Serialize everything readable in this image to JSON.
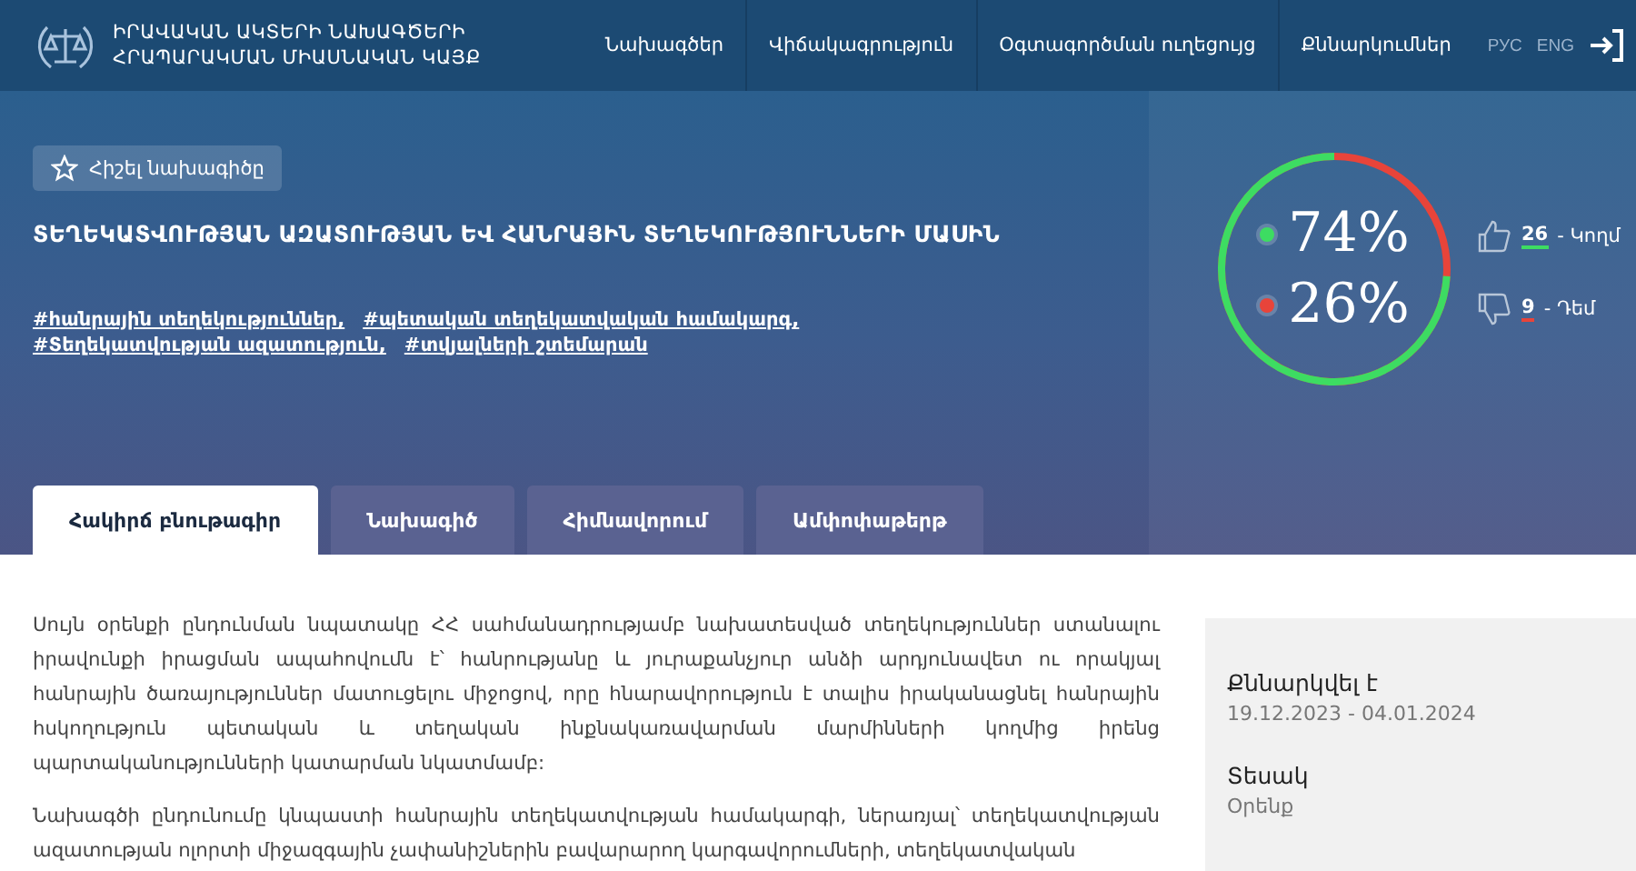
{
  "header": {
    "logo_lines": [
      "ԻՐԱՎԱԿԱՆ ԱԿՏԵՐԻ ՆԱԽԱԳԾԵՐԻ",
      "ՀՐԱՊԱՐԱԿՄԱՆ ՄԻԱՍՆԱԿԱՆ ԿԱՅՔ"
    ],
    "nav": [
      "Նախագծեր",
      "Վիճակագրություն",
      "Օգտագործման ուղեցույց",
      "Քննարկումներ"
    ],
    "languages": [
      "РУС",
      "ENG"
    ]
  },
  "hero": {
    "bookmark_button": "Հիշել նախագիծը",
    "title": "ՏԵՂԵԿԱՏՎՈՒԹՅԱՆ ԱԶԱՏՈՒԹՅԱՆ ԵՎ ՀԱՆՐԱՅԻՆ ՏԵՂԵԿՈՒԹՅՈՒՆՆԵՐԻ ՄԱՍԻՆ",
    "hashtags": [
      "#հանրային տեղեկություններ,",
      "#պետական տեղեկատվական համակարգ,",
      "#Տեղեկատվության ազատություն,",
      "#տվյալների շտեմարան"
    ],
    "votes": {
      "items": [
        {
          "percent": "74%",
          "count": "26",
          "label": "- Կողմ",
          "color": "#3ddc62",
          "kind": "up"
        },
        {
          "percent": "26%",
          "count": "9",
          "label": "- Դեմ",
          "color": "#e8443a",
          "kind": "down"
        }
      ]
    }
  },
  "tabs": [
    {
      "label": "Հակիրճ բնութագիր",
      "selected": true
    },
    {
      "label": "Նախագիծ",
      "selected": false
    },
    {
      "label": "Հիմնավորում",
      "selected": false
    },
    {
      "label": "Ամփոփաթերթ",
      "selected": false
    }
  ],
  "body": {
    "paragraphs": [
      "Սույն օրենքի ընդունման նպատակը ՀՀ սահմանադրությամբ նախատեսված տեղեկություններ ստանալու իրավունքի իրացման ապահովումն է՝ հանրությանը և յուրաքանչյուր անձի արդյունավետ ու որակյալ հանրային ծառայություններ մատուցելու միջոցով, որը հնարավորություն է տալիս իրականացնել հանրային հսկողություն պետական և տեղական ինքնակառավարման մարմինների կողմից իրենց պարտականությունների կատարման նկատմամբ:",
      "Նախագծի ընդունումը կնպաստի հանրային տեղեկատվության համակարգի, ներառյալ՝ տեղեկատվության ազատության ոլորտի միջազգային չափանիշներին բավարարող կարգավորումների, տեղեկատվական"
    ]
  },
  "sidebar": [
    {
      "label": "Քննարկվել է",
      "value": "19.12.2023 - 04.01.2024"
    },
    {
      "label": "Տեսակ",
      "value": "Օրենք"
    }
  ]
}
